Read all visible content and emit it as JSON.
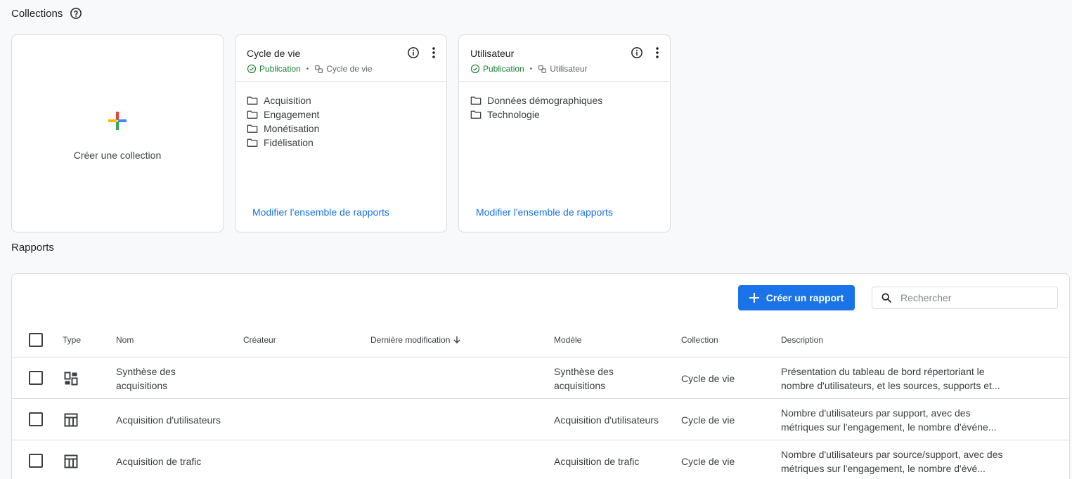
{
  "collections_section": {
    "title": "Collections",
    "help_icon": "help-circle-icon"
  },
  "create_collection": {
    "label": "Créer une collection"
  },
  "collection_cards": [
    {
      "title": "Cycle de vie",
      "status": "Publication",
      "template": "Cycle de vie",
      "items": [
        "Acquisition",
        "Engagement",
        "Monétisation",
        "Fidélisation"
      ],
      "edit_link": "Modifier l'ensemble de rapports"
    },
    {
      "title": "Utilisateur",
      "status": "Publication",
      "template": "Utilisateur",
      "items": [
        "Données démographiques",
        "Technologie"
      ],
      "edit_link": "Modifier l'ensemble de rapports"
    }
  ],
  "reports_section": {
    "title": "Rapports"
  },
  "toolbar": {
    "create_label": "Créer un rapport",
    "search_placeholder": "Rechercher"
  },
  "table": {
    "headers": {
      "type": "Type",
      "name": "Nom",
      "creator": "Créateur",
      "last_modified": "Dernière modification",
      "template": "Modèle",
      "collection": "Collection",
      "description": "Description"
    },
    "rows": [
      {
        "type_icon": "dashboard-icon",
        "name": "Synthèse des acquisitions",
        "creator": "",
        "last_modified": "",
        "template": "Synthèse des acquisitions",
        "collection": "Cycle de vie",
        "description": "Présentation du tableau de bord répertoriant le nombre d'utilisateurs, et les sources, supports et..."
      },
      {
        "type_icon": "table-icon",
        "name": "Acquisition d'utilisateurs",
        "creator": "",
        "last_modified": "",
        "template": "Acquisition d'utilisateurs",
        "collection": "Cycle de vie",
        "description": "Nombre d'utilisateurs par support, avec des métriques sur l'engagement, le nombre d'événe..."
      },
      {
        "type_icon": "table-icon",
        "name": "Acquisition de trafic",
        "creator": "",
        "last_modified": "",
        "template": "Acquisition de trafic",
        "collection": "Cycle de vie",
        "description": "Nombre d'utilisateurs par source/support, avec des métriques sur l'engagement, le nombre d'évé..."
      }
    ]
  },
  "colors": {
    "accent": "#1a73e8",
    "success": "#188038",
    "border": "#dadce0",
    "background": "#f8f9fa"
  }
}
